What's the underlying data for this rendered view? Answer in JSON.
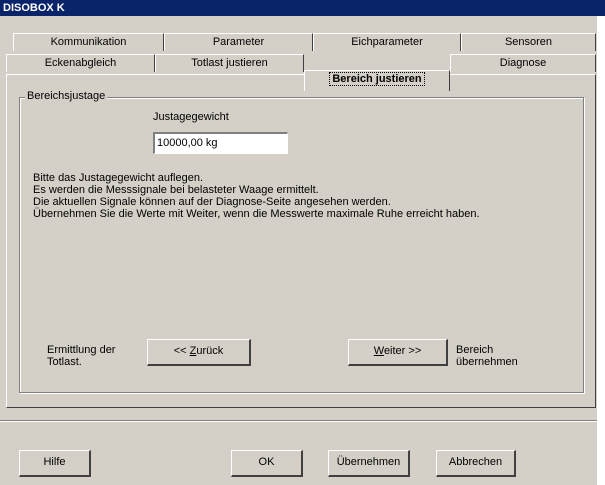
{
  "window": {
    "title": "DISOBOX K"
  },
  "tabs_row1": [
    {
      "label": "Kommunikation"
    },
    {
      "label": "Parameter"
    },
    {
      "label": "Eichparameter"
    },
    {
      "label": "Sensoren"
    }
  ],
  "tabs_row2": [
    {
      "label": "Eckenabgleich"
    },
    {
      "label": "Totlast justieren"
    },
    {
      "label": "Bereich justieren",
      "active": true
    },
    {
      "label": "Diagnose"
    }
  ],
  "group": {
    "title": "Bereichsjustage",
    "weight_label": "Justagegewicht",
    "weight_value": "10000,00 kg",
    "instructions": [
      "Bitte das Justagegewicht auflegen.",
      "Es werden die Messsignale bei belasteter Waage ermittelt.",
      "Die aktuellen Signale können auf der Diagnose-Seite angesehen werden.",
      "Übernehmen Sie die Werte mit Weiter, wenn die Messwerte maximale Ruhe erreicht haben."
    ],
    "back_caption_line1": "Ermittlung der",
    "back_caption_line2": "Totlast.",
    "back_button": {
      "prefix": "<< ",
      "underlined": "Z",
      "rest": "urück"
    },
    "next_button": {
      "underlined": "W",
      "rest": "eiter >>"
    },
    "next_caption_line1": "Bereich",
    "next_caption_line2": "übernehmen"
  },
  "footer": {
    "help": "Hilfe",
    "ok": "OK",
    "apply": "Übernehmen",
    "cancel": "Abbrechen"
  }
}
